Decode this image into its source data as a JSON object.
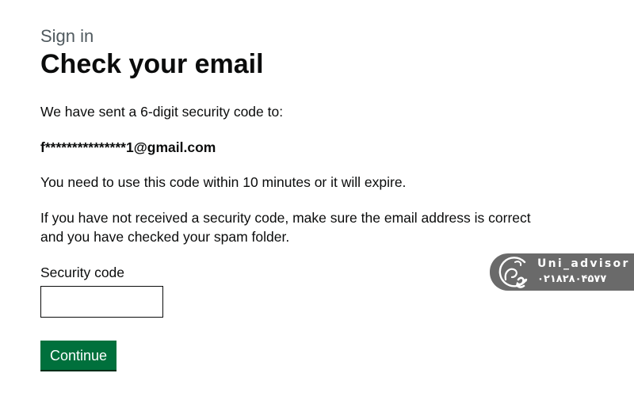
{
  "header": {
    "caption": "Sign in",
    "title": "Check your email"
  },
  "content": {
    "sent_message": "We have sent a 6-digit security code to:",
    "email_address": "f***************1@gmail.com",
    "expiry_message": "You need to use this code within 10 minutes or it will expire.",
    "help_message": "If you have not received a security code, make sure the email address is correct and you have checked your spam folder."
  },
  "form": {
    "code_label": "Security code",
    "code_value": "",
    "continue_label": "Continue"
  },
  "watermark": {
    "name": "Uni_advisor",
    "phone": "۰۲۱۸۲۸۰۴۵۷۷"
  },
  "colors": {
    "button_green": "#00703c",
    "caption_grey": "#505a5f",
    "text": "#0b0c0c",
    "watermark_bg": "#6a6a6a"
  },
  "icons": {
    "watermark_logo": "uni-advisor-logo-icon"
  }
}
